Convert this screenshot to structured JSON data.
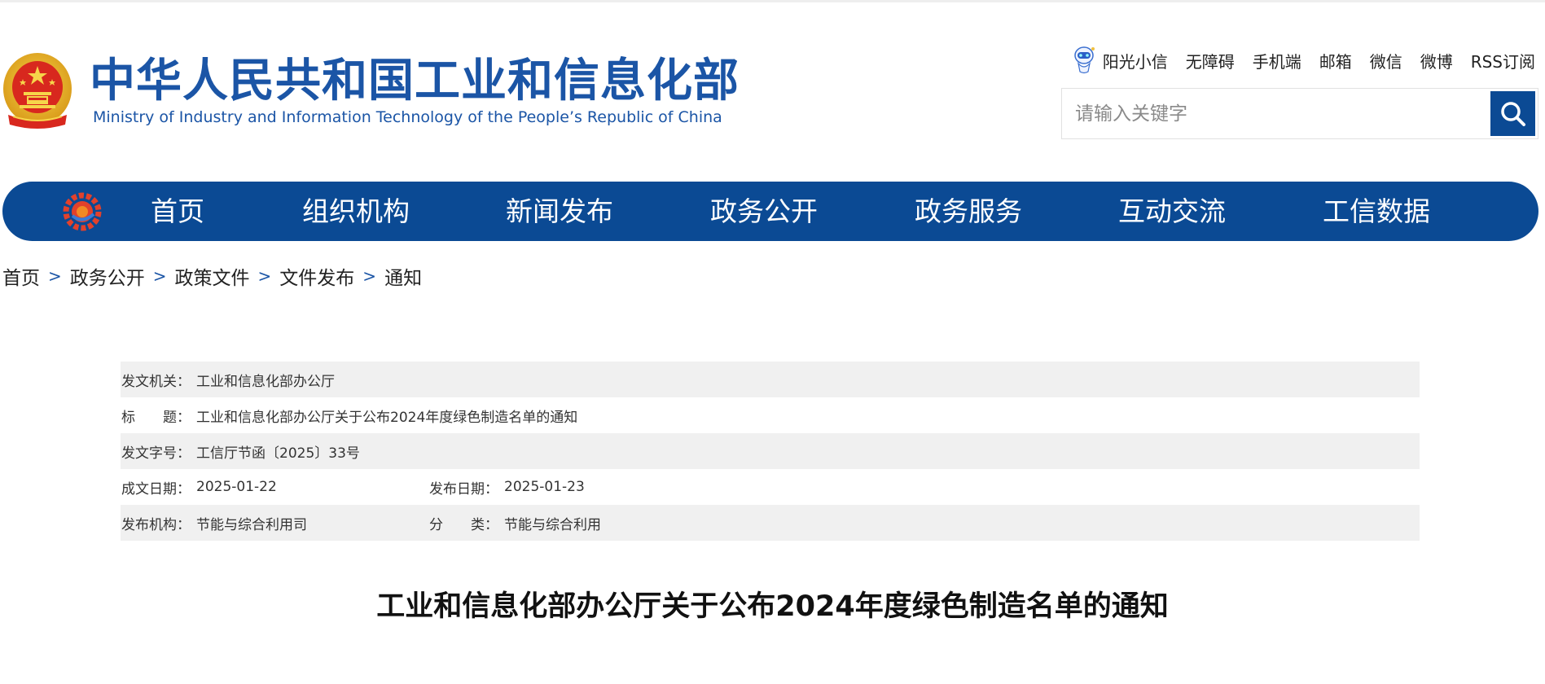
{
  "header": {
    "title_cn": "中华人民共和国工业和信息化部",
    "title_en": "Ministry of Industry and Information Technology of the People’s Republic of China"
  },
  "top_links": [
    "阳光小信",
    "无障碍",
    "手机端",
    "邮箱",
    "微信",
    "微博",
    "RSS订阅"
  ],
  "search": {
    "placeholder": "请输入关键字"
  },
  "nav": {
    "items": [
      "首页",
      "组织机构",
      "新闻发布",
      "政务公开",
      "政务服务",
      "互动交流",
      "工信数据"
    ]
  },
  "breadcrumb": {
    "items": [
      "首页",
      "政务公开",
      "政策文件",
      "文件发布",
      "通知"
    ],
    "separator": ">"
  },
  "info": {
    "issuer_label": "发文机关：",
    "issuer": "工业和信息化部办公厅",
    "title_label": "标　　题：",
    "title": "工业和信息化部办公厅关于公布2024年度绿色制造名单的通知",
    "docno_label": "发文字号：",
    "docno": "工信厅节函〔2025〕33号",
    "created_label": "成文日期：",
    "created": "2025-01-22",
    "published_label": "发布日期：",
    "published": "2025-01-23",
    "org_label": "发布机构：",
    "org": "节能与综合利用司",
    "category_label": "分　　类：",
    "category": "节能与综合利用"
  },
  "article": {
    "title": "工业和信息化部办公厅关于公布2024年度绿色制造名单的通知"
  },
  "colors": {
    "brand_blue": "#0b4a94",
    "title_blue": "#1b55a6",
    "row_gray": "#f0f0f0"
  },
  "icons": [
    "national-emblem-icon",
    "robot-icon",
    "search-icon",
    "gear-logo-icon"
  ]
}
